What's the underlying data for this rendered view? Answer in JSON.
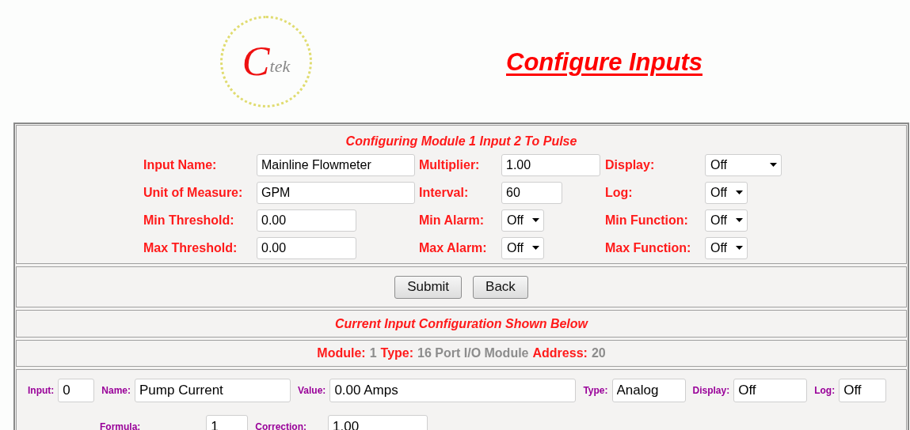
{
  "logo": {
    "initial": "C",
    "rest": "tek"
  },
  "title": "Configure Inputs",
  "form": {
    "heading": "Configuring Module 1 Input 2 To Pulse",
    "rows": [
      [
        {
          "label": "Input Name:",
          "value": "Mainline Flowmeter",
          "kind": "text"
        },
        {
          "label": "Multiplier:",
          "value": "1.00",
          "kind": "text"
        },
        {
          "label": "Display:",
          "value": "Off",
          "kind": "select"
        }
      ],
      [
        {
          "label": "Unit of Measure:",
          "value": "GPM",
          "kind": "text"
        },
        {
          "label": "Interval:",
          "value": "60",
          "kind": "text"
        },
        {
          "label": "Log:",
          "value": "Off",
          "kind": "select"
        }
      ],
      [
        {
          "label": "Min Threshold:",
          "value": "0.00",
          "kind": "text"
        },
        {
          "label": "Min Alarm:",
          "value": "Off",
          "kind": "select"
        },
        {
          "label": "Min Function:",
          "value": "Off",
          "kind": "select"
        }
      ],
      [
        {
          "label": "Max Threshold:",
          "value": "0.00",
          "kind": "text"
        },
        {
          "label": "Max Alarm:",
          "value": "Off",
          "kind": "select"
        },
        {
          "label": "Max Function:",
          "value": "Off",
          "kind": "select"
        }
      ]
    ]
  },
  "buttons": [
    "Submit",
    "Back"
  ],
  "current_heading": "Current Input Configuration Shown Below",
  "module_info": [
    {
      "label": "Module:",
      "value": "1"
    },
    {
      "label": "Type:",
      "value": "16 Port I/O Module"
    },
    {
      "label": "Address:",
      "value": "20"
    }
  ],
  "current": {
    "fields": [
      {
        "label": "Input:",
        "value": "0"
      },
      {
        "label": "Name:",
        "value": "Pump Current"
      },
      {
        "label": "Value:",
        "value": "0.00 Amps"
      },
      {
        "label": "Type:",
        "value": "Analog"
      },
      {
        "label": "Display:",
        "value": "Off"
      },
      {
        "label": "Log:",
        "value": "Off"
      }
    ],
    "formula": {
      "label": "Formula:",
      "value": "1"
    },
    "correction": {
      "label": "Correction:",
      "value": "1.00"
    }
  }
}
